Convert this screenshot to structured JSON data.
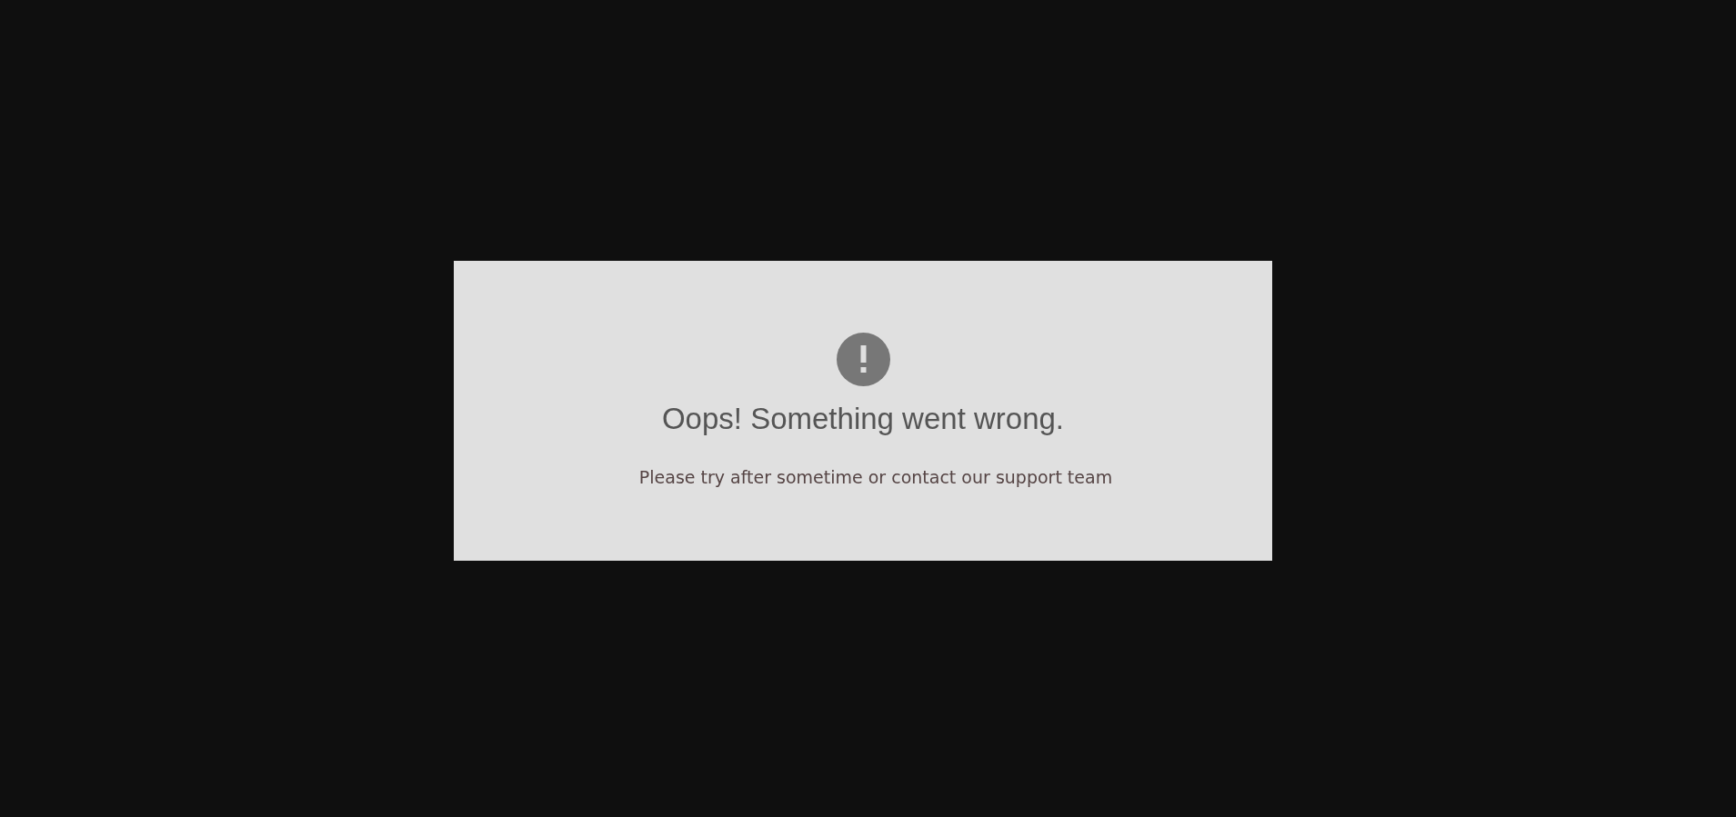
{
  "error": {
    "title": "Oops! Something went wrong.",
    "message": "Please try after sometime or contact our support team"
  }
}
